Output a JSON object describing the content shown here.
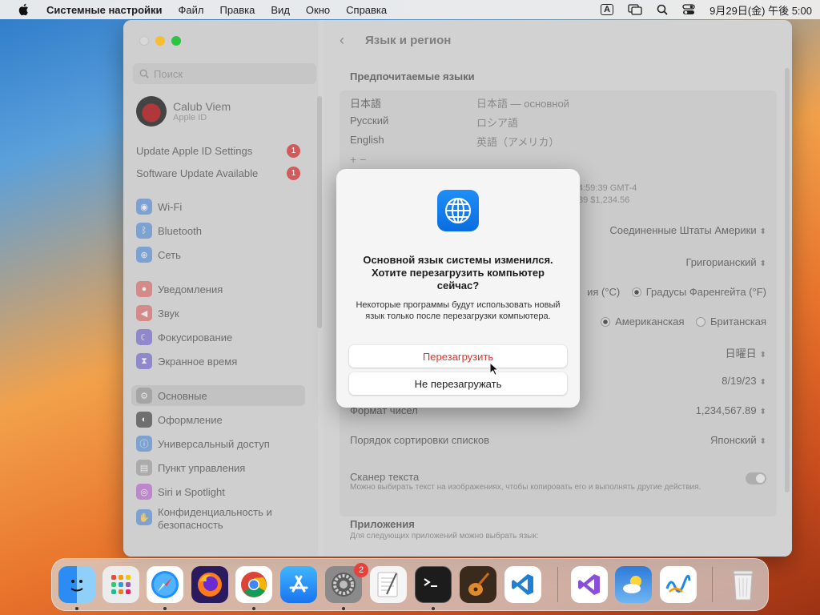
{
  "menubar": {
    "app": "Системные настройки",
    "items": [
      "Файл",
      "Правка",
      "Вид",
      "Окно",
      "Справка"
    ],
    "input_badge": "A",
    "clock": "9月29日(金) 午後 5:00"
  },
  "sidebar": {
    "search_placeholder": "Поиск",
    "profile": {
      "name": "Calub Viem",
      "sub": "Apple ID"
    },
    "notices": [
      {
        "label": "Update Apple ID Settings",
        "badge": "1"
      },
      {
        "label": "Software Update Available",
        "badge": "1"
      }
    ],
    "items": [
      {
        "label": "Wi-Fi",
        "icon": "wifi-icon",
        "color": "#3b7fd6"
      },
      {
        "label": "Bluetooth",
        "icon": "bluetooth-icon",
        "color": "#3b7fd6"
      },
      {
        "label": "Сеть",
        "icon": "network-icon",
        "color": "#3b7fd6"
      },
      {
        "label": "Уведомления",
        "icon": "notifications-icon",
        "color": "#d9534f"
      },
      {
        "label": "Звук",
        "icon": "sound-icon",
        "color": "#d9534f"
      },
      {
        "label": "Фокусирование",
        "icon": "focus-icon",
        "color": "#5b4fc8"
      },
      {
        "label": "Экранное время",
        "icon": "screen-time-icon",
        "color": "#5b4fc8"
      },
      {
        "label": "Основные",
        "icon": "general-icon",
        "color": "#8e8e8e"
      },
      {
        "label": "Оформление",
        "icon": "appearance-icon",
        "color": "#222222"
      },
      {
        "label": "Универсальный доступ",
        "icon": "accessibility-icon",
        "color": "#3b7fd6"
      },
      {
        "label": "Пункт управления",
        "icon": "control-center-icon",
        "color": "#8e8e8e"
      },
      {
        "label": "Siri и Spotlight",
        "icon": "siri-icon",
        "color": "#b04fc8"
      },
      {
        "label": "Конфиденциальность и безопасность",
        "icon": "privacy-hand-icon",
        "color": "#3b7fd6"
      }
    ]
  },
  "main": {
    "title": "Язык и регион",
    "preferred_header": "Предпочитаемые языки",
    "languages": [
      {
        "name": "日本語",
        "desc": "日本語 — основной"
      },
      {
        "name": "Русский",
        "desc": "ロシア語"
      },
      {
        "name": "English",
        "desc": "英語（アメリカ）"
      }
    ],
    "add_remove": "+  −",
    "preview_line1": "4:59:39 GMT-4",
    "preview_line2": "89    $1,234.56",
    "region_value": "Соединенные Штаты Америки",
    "calendar_value": "Григорианский",
    "temp_c_partial": "ия (°C)",
    "temp_f": "Градусы Фаренгейта (°F)",
    "measure_us": "Американская",
    "measure_uk": "Британская",
    "first_day_value": "日曜日",
    "date_format_value": "8/19/23",
    "number_format_label": "Формат чисел",
    "number_format_value": "1,234,567.89",
    "sort_label": "Порядок сортировки списков",
    "sort_value": "Японский",
    "scanner_label": "Сканер текста",
    "scanner_desc": "Можно выбирать текст на изображениях, чтобы копировать его и выполнять другие действия.",
    "apps_header": "Приложения",
    "apps_desc": "Для следующих приложений можно выбрать язык:"
  },
  "dialog": {
    "title": "Основной язык системы изменился. Хотите перезагрузить компьютер сейчас?",
    "message": "Некоторые программы будут использовать новый язык только после перезагрузки компьютера.",
    "restart": "Перезагрузить",
    "dont_restart": "Не перезагружать"
  },
  "dock": {
    "apps": [
      "finder-icon",
      "launchpad-icon",
      "safari-icon",
      "firefox-icon",
      "chrome-icon",
      "app-store-icon",
      "system-settings-icon",
      "textedit-icon",
      "terminal-icon",
      "garageband-icon",
      "vscode-icon",
      "visual-studio-icon",
      "weather-icon",
      "freeform-icon",
      "trash-icon"
    ],
    "settings_badge": "2"
  }
}
